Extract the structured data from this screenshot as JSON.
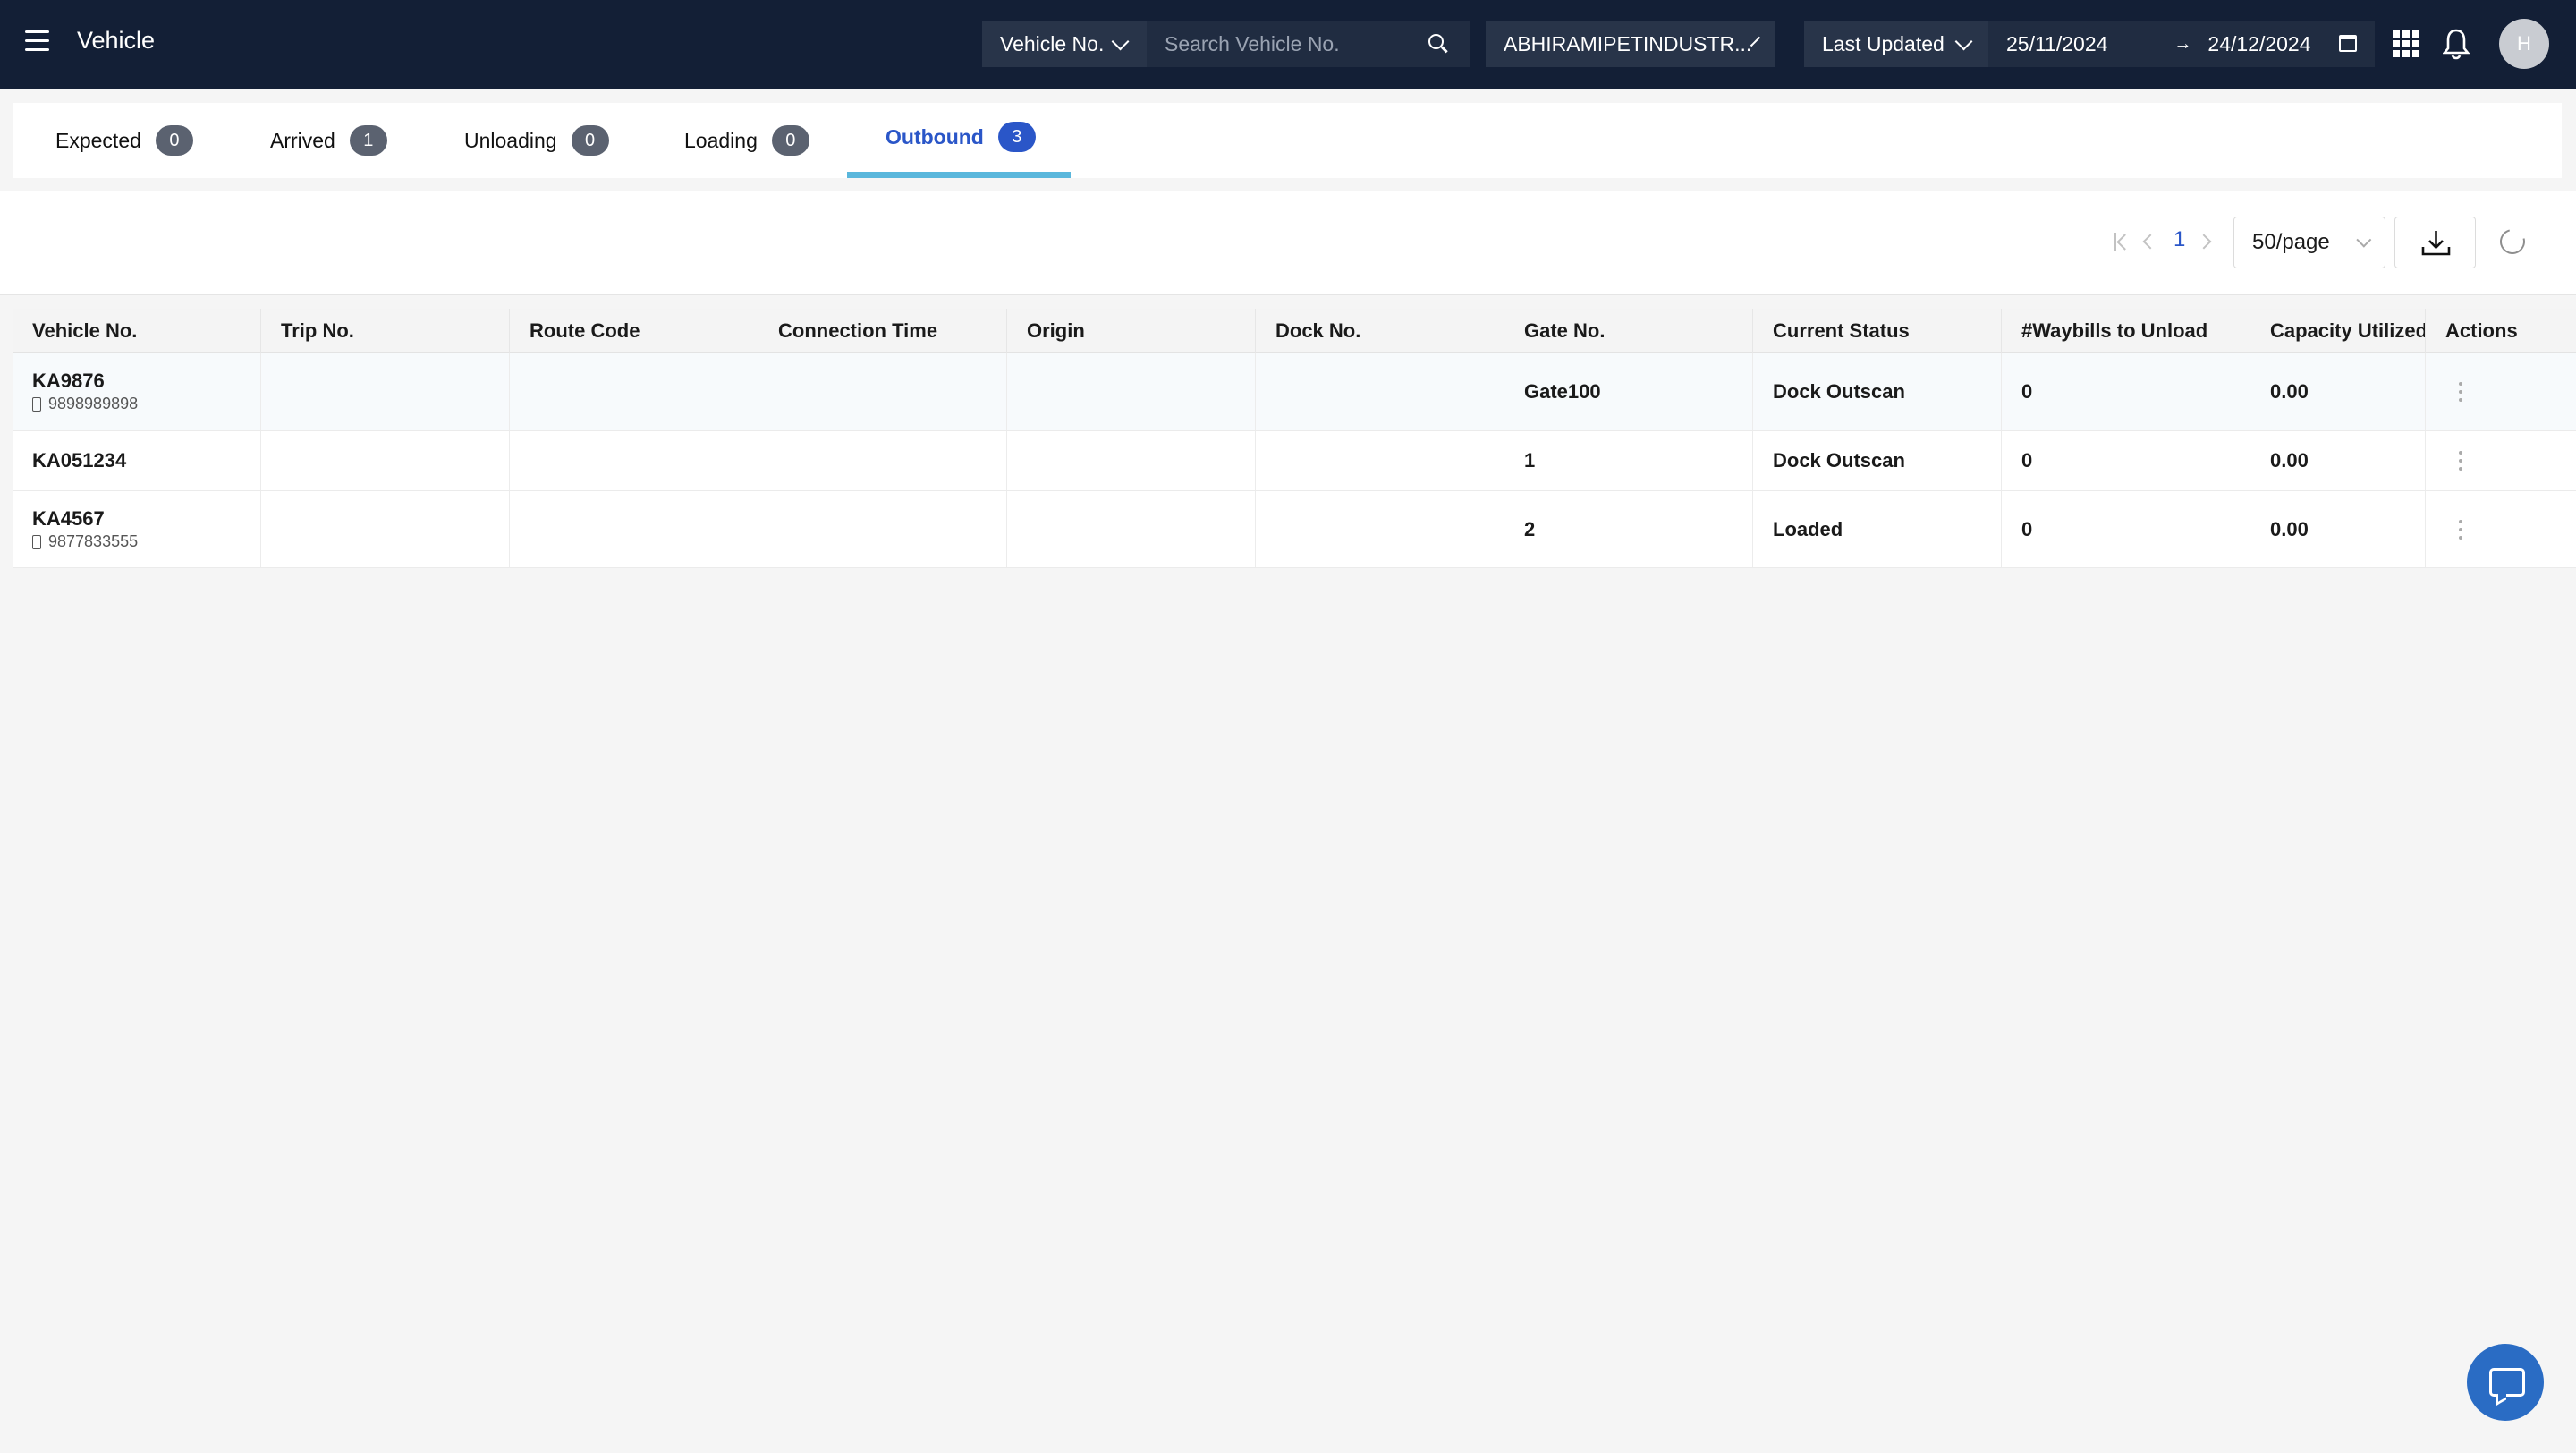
{
  "header": {
    "title": "Vehicle",
    "filter_type": "Vehicle No.",
    "search_placeholder": "Search Vehicle No.",
    "facility": "ABHIRAMIPETINDUSTR...",
    "sort_by": "Last Updated",
    "date_from": "25/11/2024",
    "date_to": "24/12/2024",
    "avatar_initial": "H"
  },
  "tabs": [
    {
      "label": "Expected",
      "count": "0",
      "active": false
    },
    {
      "label": "Arrived",
      "count": "1",
      "active": false
    },
    {
      "label": "Unloading",
      "count": "0",
      "active": false
    },
    {
      "label": "Loading",
      "count": "0",
      "active": false
    },
    {
      "label": "Outbound",
      "count": "3",
      "active": true
    }
  ],
  "pagination": {
    "current_page": "1",
    "page_size": "50/page"
  },
  "table": {
    "columns": [
      "Vehicle No.",
      "Trip No.",
      "Route Code",
      "Connection Time",
      "Origin",
      "Dock No.",
      "Gate No.",
      "Current Status",
      "#Waybills to Unload",
      "Capacity Utilized",
      "Actions"
    ],
    "rows": [
      {
        "vehicle_no": "KA9876",
        "phone": "9898989898",
        "trip_no": "",
        "route_code": "",
        "connection_time": "",
        "origin": "",
        "dock_no": "",
        "gate_no": "Gate100",
        "status": "Dock Outscan",
        "waybills": "0",
        "capacity": "0.00"
      },
      {
        "vehicle_no": "KA051234",
        "phone": "",
        "trip_no": "",
        "route_code": "",
        "connection_time": "",
        "origin": "",
        "dock_no": "",
        "gate_no": "1",
        "status": "Dock Outscan",
        "waybills": "0",
        "capacity": "0.00"
      },
      {
        "vehicle_no": "KA4567",
        "phone": "9877833555",
        "trip_no": "",
        "route_code": "",
        "connection_time": "",
        "origin": "",
        "dock_no": "",
        "gate_no": "2",
        "status": "Loaded",
        "waybills": "0",
        "capacity": "0.00"
      }
    ]
  },
  "icons": {
    "menu": "hamburger-icon",
    "search": "search-icon",
    "calendar": "calendar-icon",
    "apps": "grid-icon",
    "notifications": "bell-icon",
    "download": "download-icon",
    "refresh": "refresh-icon",
    "chat": "chat-icon"
  },
  "colors": {
    "header_bg": "#131f36",
    "accent": "#2a56c8",
    "tab_underline": "#5ab7dc",
    "chat_fab": "#2a6cc4"
  }
}
